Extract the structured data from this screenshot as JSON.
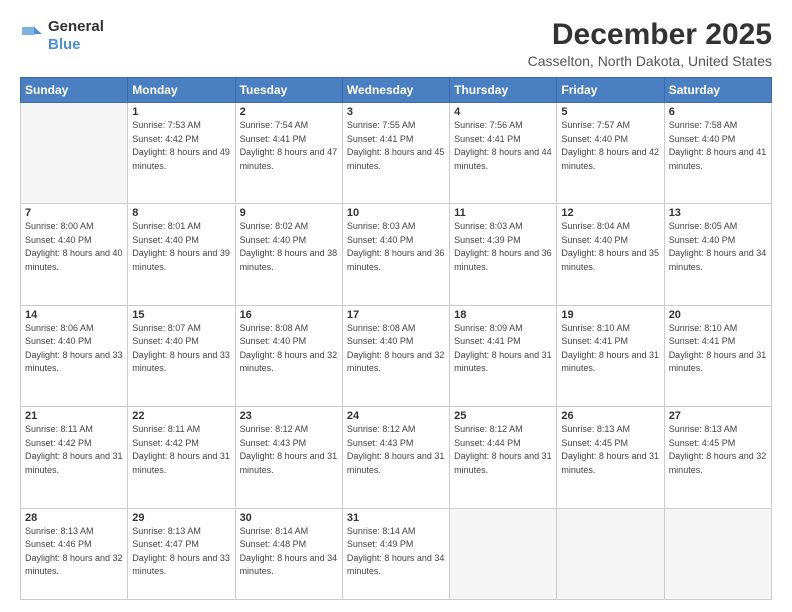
{
  "header": {
    "logo_line1": "General",
    "logo_line2": "Blue",
    "month": "December 2025",
    "location": "Casselton, North Dakota, United States"
  },
  "weekdays": [
    "Sunday",
    "Monday",
    "Tuesday",
    "Wednesday",
    "Thursday",
    "Friday",
    "Saturday"
  ],
  "weeks": [
    [
      {
        "day": "",
        "sunrise": "",
        "sunset": "",
        "daylight": ""
      },
      {
        "day": "1",
        "sunrise": "Sunrise: 7:53 AM",
        "sunset": "Sunset: 4:42 PM",
        "daylight": "Daylight: 8 hours and 49 minutes."
      },
      {
        "day": "2",
        "sunrise": "Sunrise: 7:54 AM",
        "sunset": "Sunset: 4:41 PM",
        "daylight": "Daylight: 8 hours and 47 minutes."
      },
      {
        "day": "3",
        "sunrise": "Sunrise: 7:55 AM",
        "sunset": "Sunset: 4:41 PM",
        "daylight": "Daylight: 8 hours and 45 minutes."
      },
      {
        "day": "4",
        "sunrise": "Sunrise: 7:56 AM",
        "sunset": "Sunset: 4:41 PM",
        "daylight": "Daylight: 8 hours and 44 minutes."
      },
      {
        "day": "5",
        "sunrise": "Sunrise: 7:57 AM",
        "sunset": "Sunset: 4:40 PM",
        "daylight": "Daylight: 8 hours and 42 minutes."
      },
      {
        "day": "6",
        "sunrise": "Sunrise: 7:58 AM",
        "sunset": "Sunset: 4:40 PM",
        "daylight": "Daylight: 8 hours and 41 minutes."
      }
    ],
    [
      {
        "day": "7",
        "sunrise": "Sunrise: 8:00 AM",
        "sunset": "Sunset: 4:40 PM",
        "daylight": "Daylight: 8 hours and 40 minutes."
      },
      {
        "day": "8",
        "sunrise": "Sunrise: 8:01 AM",
        "sunset": "Sunset: 4:40 PM",
        "daylight": "Daylight: 8 hours and 39 minutes."
      },
      {
        "day": "9",
        "sunrise": "Sunrise: 8:02 AM",
        "sunset": "Sunset: 4:40 PM",
        "daylight": "Daylight: 8 hours and 38 minutes."
      },
      {
        "day": "10",
        "sunrise": "Sunrise: 8:03 AM",
        "sunset": "Sunset: 4:40 PM",
        "daylight": "Daylight: 8 hours and 36 minutes."
      },
      {
        "day": "11",
        "sunrise": "Sunrise: 8:03 AM",
        "sunset": "Sunset: 4:39 PM",
        "daylight": "Daylight: 8 hours and 36 minutes."
      },
      {
        "day": "12",
        "sunrise": "Sunrise: 8:04 AM",
        "sunset": "Sunset: 4:40 PM",
        "daylight": "Daylight: 8 hours and 35 minutes."
      },
      {
        "day": "13",
        "sunrise": "Sunrise: 8:05 AM",
        "sunset": "Sunset: 4:40 PM",
        "daylight": "Daylight: 8 hours and 34 minutes."
      }
    ],
    [
      {
        "day": "14",
        "sunrise": "Sunrise: 8:06 AM",
        "sunset": "Sunset: 4:40 PM",
        "daylight": "Daylight: 8 hours and 33 minutes."
      },
      {
        "day": "15",
        "sunrise": "Sunrise: 8:07 AM",
        "sunset": "Sunset: 4:40 PM",
        "daylight": "Daylight: 8 hours and 33 minutes."
      },
      {
        "day": "16",
        "sunrise": "Sunrise: 8:08 AM",
        "sunset": "Sunset: 4:40 PM",
        "daylight": "Daylight: 8 hours and 32 minutes."
      },
      {
        "day": "17",
        "sunrise": "Sunrise: 8:08 AM",
        "sunset": "Sunset: 4:40 PM",
        "daylight": "Daylight: 8 hours and 32 minutes."
      },
      {
        "day": "18",
        "sunrise": "Sunrise: 8:09 AM",
        "sunset": "Sunset: 4:41 PM",
        "daylight": "Daylight: 8 hours and 31 minutes."
      },
      {
        "day": "19",
        "sunrise": "Sunrise: 8:10 AM",
        "sunset": "Sunset: 4:41 PM",
        "daylight": "Daylight: 8 hours and 31 minutes."
      },
      {
        "day": "20",
        "sunrise": "Sunrise: 8:10 AM",
        "sunset": "Sunset: 4:41 PM",
        "daylight": "Daylight: 8 hours and 31 minutes."
      }
    ],
    [
      {
        "day": "21",
        "sunrise": "Sunrise: 8:11 AM",
        "sunset": "Sunset: 4:42 PM",
        "daylight": "Daylight: 8 hours and 31 minutes."
      },
      {
        "day": "22",
        "sunrise": "Sunrise: 8:11 AM",
        "sunset": "Sunset: 4:42 PM",
        "daylight": "Daylight: 8 hours and 31 minutes."
      },
      {
        "day": "23",
        "sunrise": "Sunrise: 8:12 AM",
        "sunset": "Sunset: 4:43 PM",
        "daylight": "Daylight: 8 hours and 31 minutes."
      },
      {
        "day": "24",
        "sunrise": "Sunrise: 8:12 AM",
        "sunset": "Sunset: 4:43 PM",
        "daylight": "Daylight: 8 hours and 31 minutes."
      },
      {
        "day": "25",
        "sunrise": "Sunrise: 8:12 AM",
        "sunset": "Sunset: 4:44 PM",
        "daylight": "Daylight: 8 hours and 31 minutes."
      },
      {
        "day": "26",
        "sunrise": "Sunrise: 8:13 AM",
        "sunset": "Sunset: 4:45 PM",
        "daylight": "Daylight: 8 hours and 31 minutes."
      },
      {
        "day": "27",
        "sunrise": "Sunrise: 8:13 AM",
        "sunset": "Sunset: 4:45 PM",
        "daylight": "Daylight: 8 hours and 32 minutes."
      }
    ],
    [
      {
        "day": "28",
        "sunrise": "Sunrise: 8:13 AM",
        "sunset": "Sunset: 4:46 PM",
        "daylight": "Daylight: 8 hours and 32 minutes."
      },
      {
        "day": "29",
        "sunrise": "Sunrise: 8:13 AM",
        "sunset": "Sunset: 4:47 PM",
        "daylight": "Daylight: 8 hours and 33 minutes."
      },
      {
        "day": "30",
        "sunrise": "Sunrise: 8:14 AM",
        "sunset": "Sunset: 4:48 PM",
        "daylight": "Daylight: 8 hours and 34 minutes."
      },
      {
        "day": "31",
        "sunrise": "Sunrise: 8:14 AM",
        "sunset": "Sunset: 4:49 PM",
        "daylight": "Daylight: 8 hours and 34 minutes."
      },
      {
        "day": "",
        "sunrise": "",
        "sunset": "",
        "daylight": ""
      },
      {
        "day": "",
        "sunrise": "",
        "sunset": "",
        "daylight": ""
      },
      {
        "day": "",
        "sunrise": "",
        "sunset": "",
        "daylight": ""
      }
    ]
  ]
}
